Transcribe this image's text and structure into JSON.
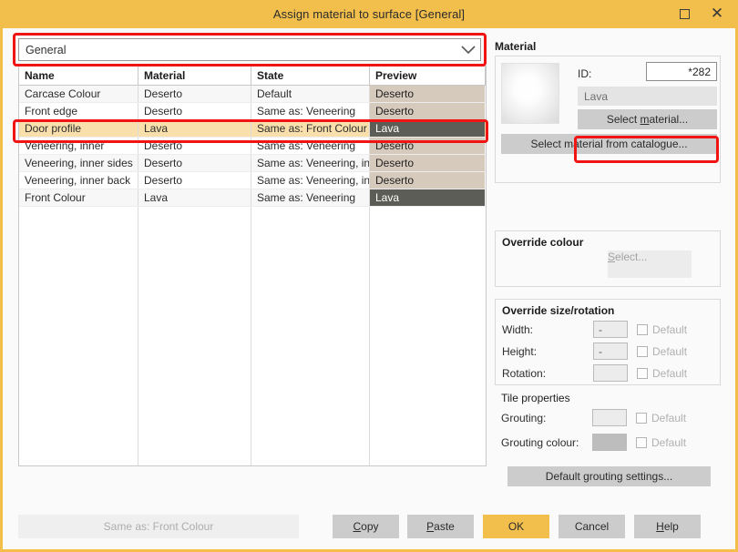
{
  "window": {
    "title": "Assign material to surface [General]",
    "maximize_icon": "maximize-icon",
    "close_icon": "close-icon"
  },
  "category_combo": {
    "value": "General",
    "arrow_icon": "chevron-down-icon"
  },
  "table": {
    "columns": [
      "Name",
      "Material",
      "State",
      "Preview"
    ],
    "rows": [
      {
        "name": "Carcase Colour",
        "material": "Deserto",
        "state": "Default",
        "preview": "Deserto",
        "preview_color": "#d6cabc",
        "preview_text_color": "#1f1f1f",
        "selected": false
      },
      {
        "name": "Front edge",
        "material": "Deserto",
        "state": "Same as: Veneering",
        "preview": "Deserto",
        "preview_color": "#d6cabc",
        "preview_text_color": "#1f1f1f",
        "selected": false
      },
      {
        "name": "Door profile",
        "material": "Lava",
        "state": "Same as: Front Colour",
        "preview": "Lava",
        "preview_color": "#5d5d57",
        "preview_text_color": "#ffffff",
        "selected": true
      },
      {
        "name": "Veneering, inner",
        "material": "Deserto",
        "state": "Same as: Veneering",
        "preview": "Deserto",
        "preview_color": "#d6cabc",
        "preview_text_color": "#1f1f1f",
        "selected": false
      },
      {
        "name": "Veneering, inner sides",
        "material": "Deserto",
        "state": "Same as: Veneering, inner",
        "preview": "Deserto",
        "preview_color": "#d6cabc",
        "preview_text_color": "#1f1f1f",
        "selected": false
      },
      {
        "name": "Veneering, inner back",
        "material": "Deserto",
        "state": "Same as: Veneering, inner",
        "preview": "Deserto",
        "preview_color": "#d6cabc",
        "preview_text_color": "#1f1f1f",
        "selected": false
      },
      {
        "name": "Front Colour",
        "material": "Lava",
        "state": "Same as: Veneering",
        "preview": "Lava",
        "preview_color": "#5d5d57",
        "preview_text_color": "#ffffff",
        "selected": false
      }
    ]
  },
  "material_panel": {
    "section_title": "Material",
    "id_label": "ID:",
    "id_value": "*282",
    "material_name": "Lava",
    "select_material_button": "Select material...",
    "select_material_accel": "m",
    "select_catalogue_button": "Select material from catalogue..."
  },
  "override_colour": {
    "title": "Override colour",
    "select_button": "Select...",
    "select_accel": "S"
  },
  "override_size": {
    "title": "Override size/rotation",
    "fields": [
      {
        "label": "Width:",
        "value": "-",
        "checkbox_label": "Default",
        "checked": false
      },
      {
        "label": "Height:",
        "value": "-",
        "checkbox_label": "Default",
        "checked": false
      },
      {
        "label": "Rotation:",
        "value": "",
        "checkbox_label": "Default",
        "checked": false
      }
    ]
  },
  "tile_properties": {
    "title": "Tile properties",
    "fields": [
      {
        "label": "Grouting:",
        "value": "",
        "swatch_color": "#ececec",
        "checkbox_label": "Default",
        "checked": false
      },
      {
        "label": "Grouting colour:",
        "value": "",
        "swatch_color": "#bdbdbd",
        "checkbox_label": "Default",
        "checked": false
      }
    ],
    "default_settings_button": "Default grouting settings..."
  },
  "footer": {
    "status_button": "Same as: Front Colour",
    "copy": "Copy",
    "copy_accel": "C",
    "paste": "Paste",
    "paste_accel": "P",
    "ok": "OK",
    "cancel": "Cancel",
    "help": "Help",
    "help_accel": "H"
  },
  "colors": {
    "titlebar": "#f2bf4c",
    "accent_ok": "#f2bf4c",
    "annotation": "#f01414",
    "selected_row": "#f8dfab"
  }
}
